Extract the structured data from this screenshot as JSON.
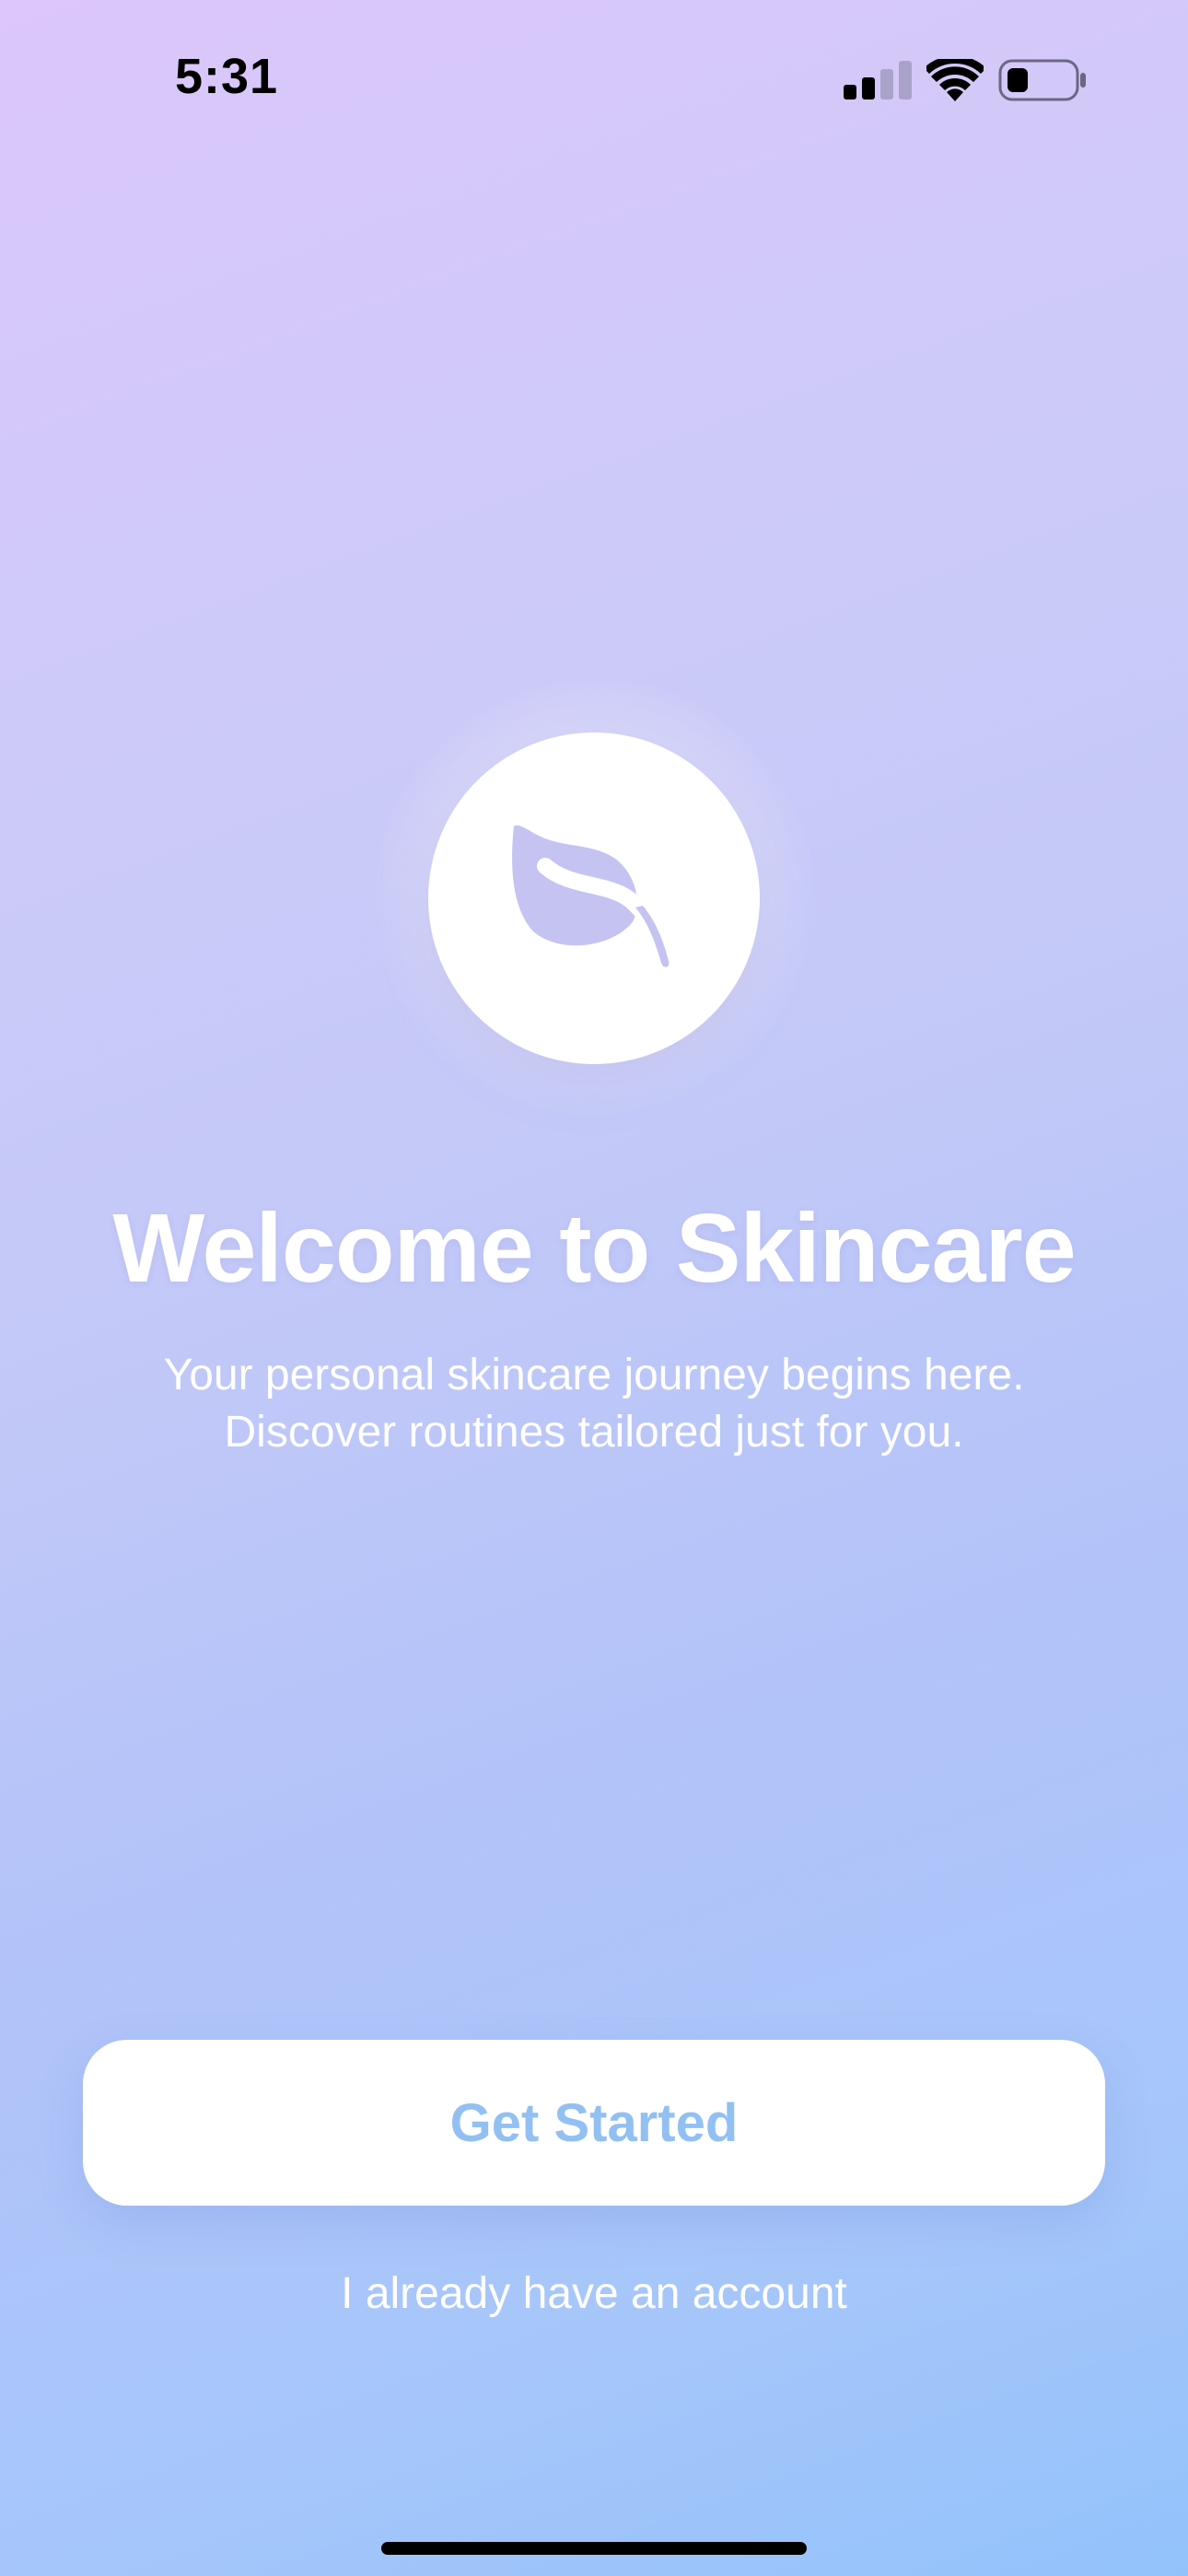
{
  "status_bar": {
    "time": "5:31",
    "signal_icon": "cellular-signal-icon",
    "wifi_icon": "wifi-icon",
    "battery_icon": "battery-low-icon",
    "battery_level": 0.25
  },
  "logo": {
    "icon": "leaf-icon",
    "color": "#c3c3f2"
  },
  "welcome": {
    "title": "Welcome to Skincare",
    "subtitle_line1": "Your personal skincare journey begins here.",
    "subtitle_line2": "Discover routines tailored just for you."
  },
  "actions": {
    "primary_label": "Get Started",
    "secondary_label": "I already have an account"
  },
  "colors": {
    "gradient_top": "#dcc6fb",
    "gradient_bottom": "#93c2fb",
    "button_text": "#93c0f2"
  }
}
